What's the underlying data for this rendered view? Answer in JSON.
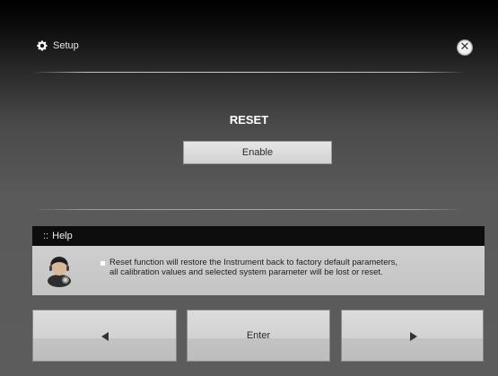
{
  "header": {
    "title": "Setup",
    "settings_icon": "gear-icon",
    "close_icon": "close-icon",
    "close_symbol": "✕"
  },
  "reset": {
    "title": "RESET",
    "button_label": "Enable"
  },
  "help": {
    "marker": "::",
    "title": "Help",
    "icon": "support-person-icon",
    "line1": "Reset function will restore the Instrument back to factory default parameters,",
    "line2": "all calibration values and selected system parameter will be lost or reset."
  },
  "nav": {
    "prev_icon": "arrow-left-icon",
    "enter_label": "Enter",
    "next_icon": "arrow-right-icon"
  },
  "colors": {
    "background": "#5a5a5a",
    "header_bg": "#000000",
    "help_bar": "#0d0d0d",
    "button_face": "#d6d6d6"
  }
}
